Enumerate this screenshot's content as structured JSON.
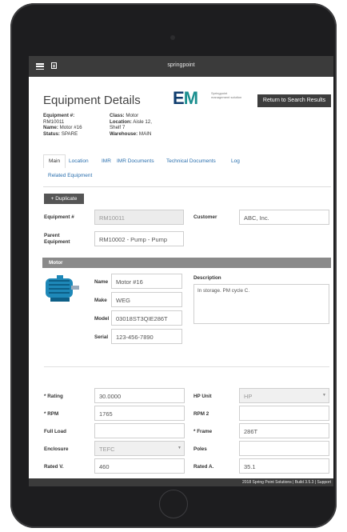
{
  "app": {
    "name": "springpoint"
  },
  "header": {
    "title": "Equipment Details",
    "return_label": "Return to Search Results"
  },
  "logo": {
    "mark_e": "E",
    "mark_m": "M",
    "tagline": "Springpoint management solution"
  },
  "meta": {
    "equipment_label": "Equipment #:",
    "equipment_value": "RM10011",
    "name_label": "Name:",
    "name_value": "Motor #16",
    "status_label": "Status:",
    "status_value": "SPARE",
    "class_label": "Class:",
    "class_value": "Motor",
    "location_label": "Location:",
    "location_value": "Aisle 12,",
    "location_value2": "Shelf 7",
    "warehouse_label": "Warehouse:",
    "warehouse_value": "MAIN"
  },
  "tabs": [
    "Main",
    "Location",
    "IMR",
    "IMR Documents",
    "Technical Documents",
    "Log",
    "Related Equipment"
  ],
  "actions": {
    "duplicate_label": "+ Duplicate"
  },
  "top_fields": {
    "equipment_label": "Equipment #",
    "equipment_value": "RM10011",
    "customer_label": "Customer",
    "customer_value": "ABC, Inc.",
    "parent_label": "Parent Equipment",
    "parent_value": "RM10002 - Pump - Pump"
  },
  "motor_section": {
    "title": "Motor",
    "name_label": "Name",
    "name_value": "Motor #16",
    "make_label": "Make",
    "make_value": "WEG",
    "model_label": "Model",
    "model_value": "03018ST3QIE286T",
    "serial_label": "Serial",
    "serial_value": "123-456-7890",
    "description_label": "Description",
    "description_value": "In storage. PM cycle C."
  },
  "specs": {
    "rating_label": "* Rating",
    "rating_value": "30.0000",
    "hp_unit_label": "HP Unit",
    "hp_unit_value": "HP",
    "rpm_label": "* RPM",
    "rpm_value": "1765",
    "rpm2_label": "RPM 2",
    "rpm2_value": "",
    "full_load_label": "Full Load",
    "full_load_value": "",
    "frame_label": "* Frame",
    "frame_value": "286T",
    "enclosure_label": "Enclosure",
    "enclosure_value": "TEFC",
    "poles_label": "Poles",
    "poles_value": "",
    "rated_v_label": "Rated V.",
    "rated_v_value": "460",
    "rated_a_label": "Rated A.",
    "rated_a_value": "35.1"
  },
  "footer": {
    "text": "2018 Spring Point Solutions | Build 3.5.3 | Support"
  },
  "colors": {
    "topbar": "#3b3b3b",
    "link": "#2a6fae",
    "section": "#8a8a8a",
    "motor": "#1e88b8"
  },
  "icons": [
    "hamburger-icon",
    "grid-icon",
    "motor-image",
    "caret-down-icon"
  ]
}
